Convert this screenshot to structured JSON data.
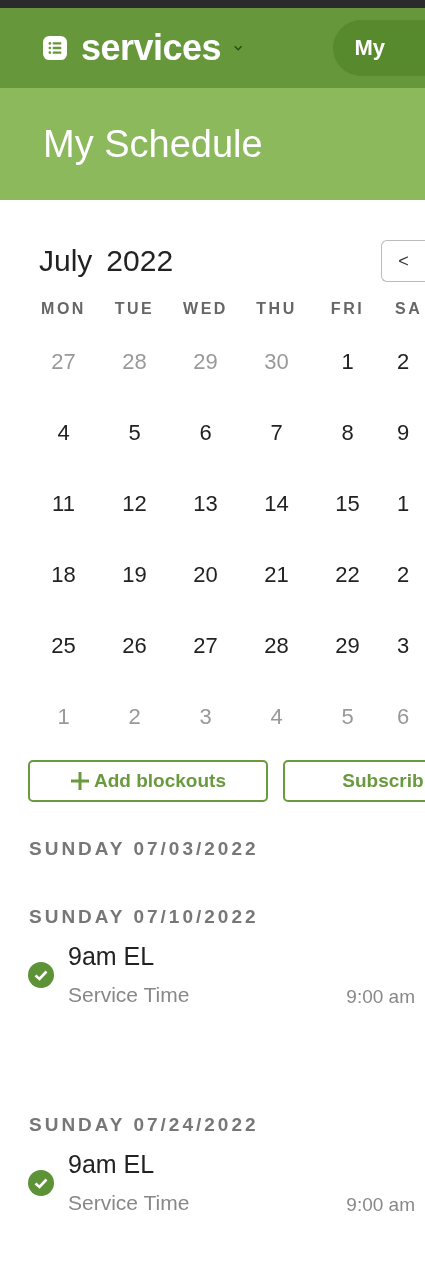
{
  "app_bar": {
    "app_name": "services",
    "nav_pill": "My"
  },
  "page_title": "My Schedule",
  "calendar": {
    "month": "July",
    "year": "2022",
    "prev_button": "<",
    "weekdays": [
      "MON",
      "TUE",
      "WED",
      "THU",
      "FRI",
      "SA"
    ],
    "weeks": [
      [
        {
          "day": "27",
          "muted": true
        },
        {
          "day": "28",
          "muted": true
        },
        {
          "day": "29",
          "muted": true
        },
        {
          "day": "30",
          "muted": true
        },
        {
          "day": "1",
          "muted": false
        },
        {
          "day": "2",
          "muted": false
        }
      ],
      [
        {
          "day": "4",
          "muted": false
        },
        {
          "day": "5",
          "muted": false
        },
        {
          "day": "6",
          "muted": false
        },
        {
          "day": "7",
          "muted": false
        },
        {
          "day": "8",
          "muted": false
        },
        {
          "day": "9",
          "muted": false
        }
      ],
      [
        {
          "day": "11",
          "muted": false
        },
        {
          "day": "12",
          "muted": false
        },
        {
          "day": "13",
          "muted": false
        },
        {
          "day": "14",
          "muted": false
        },
        {
          "day": "15",
          "muted": false
        },
        {
          "day": "1",
          "muted": false
        }
      ],
      [
        {
          "day": "18",
          "muted": false
        },
        {
          "day": "19",
          "muted": false
        },
        {
          "day": "20",
          "muted": false
        },
        {
          "day": "21",
          "muted": false
        },
        {
          "day": "22",
          "muted": false
        },
        {
          "day": "2",
          "muted": false
        }
      ],
      [
        {
          "day": "25",
          "muted": false
        },
        {
          "day": "26",
          "muted": false
        },
        {
          "day": "27",
          "muted": false
        },
        {
          "day": "28",
          "muted": false
        },
        {
          "day": "29",
          "muted": false
        },
        {
          "day": "3",
          "muted": false
        }
      ],
      [
        {
          "day": "1",
          "muted": true
        },
        {
          "day": "2",
          "muted": true
        },
        {
          "day": "3",
          "muted": true
        },
        {
          "day": "4",
          "muted": true
        },
        {
          "day": "5",
          "muted": true
        },
        {
          "day": "6",
          "muted": true
        }
      ]
    ]
  },
  "actions": [
    {
      "label": "Add blockouts",
      "kind": "add"
    },
    {
      "label": "Subscrib",
      "kind": "plain"
    }
  ],
  "schedule": [
    {
      "date": "SUNDAY 07/03/2022"
    },
    {
      "date": "SUNDAY 07/10/2022",
      "events": [
        {
          "title": "9am EL",
          "subtitle": "Service Time",
          "time": "9:00 am",
          "confirmed": true
        }
      ]
    },
    {
      "date": "SUNDAY 07/24/2022",
      "events": [
        {
          "title": "9am EL",
          "subtitle": "Service Time",
          "time": "9:00 am",
          "confirmed": true
        }
      ]
    }
  ]
}
